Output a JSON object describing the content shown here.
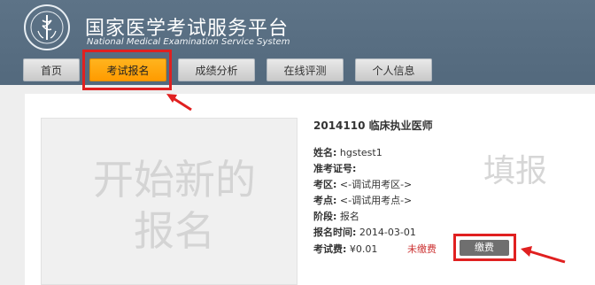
{
  "header": {
    "title": "国家医学考试服务平台",
    "subtitle": "National Medical Examination Service System",
    "logo_icon": "medical-emblem-icon"
  },
  "nav": {
    "tabs": [
      {
        "label": "首页",
        "active": false
      },
      {
        "label": "考试报名",
        "active": true
      },
      {
        "label": "成绩分析",
        "active": false
      },
      {
        "label": "在线评测",
        "active": false
      },
      {
        "label": "个人信息",
        "active": false
      }
    ]
  },
  "new_registration": {
    "label": "开始新的报名"
  },
  "registration": {
    "title": "2014110 临床执业医师",
    "watermark": "填报",
    "fields": [
      {
        "label": "姓名:",
        "value": "hgstest1"
      },
      {
        "label": "准考证号:",
        "value": ""
      },
      {
        "label": "考区:",
        "value": "<-调试用考区->"
      },
      {
        "label": "考点:",
        "value": "<-调试用考点->"
      },
      {
        "label": "阶段:",
        "value": "报名"
      },
      {
        "label": "报名时间:",
        "value": "2014-03-01"
      },
      {
        "label": "考试费:",
        "value": "¥0.01"
      }
    ],
    "fee_status": "未缴费",
    "pay_button": "缴费"
  },
  "colors": {
    "header": "#56697c",
    "active_tab": "#ff9f00",
    "highlight": "#e02020",
    "unpaid": "#cc3333"
  }
}
